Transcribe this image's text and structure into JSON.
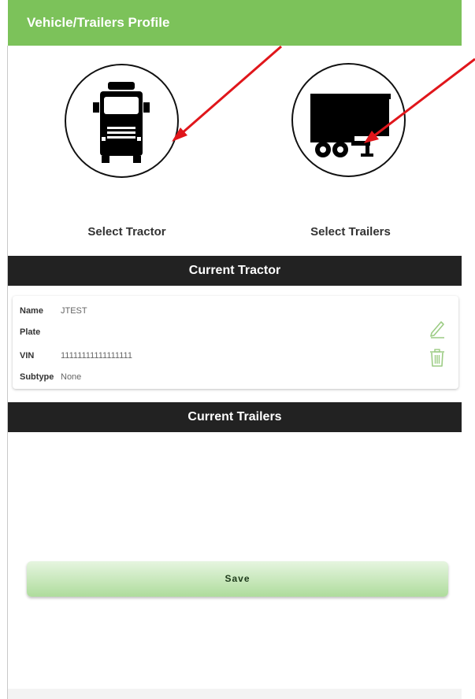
{
  "header": {
    "title": "Vehicle/Trailers Profile"
  },
  "select_tractor": {
    "label": "Select Tractor",
    "icon": "truck-icon"
  },
  "select_trailers": {
    "label": "Select Trailers",
    "icon": "trailer-icon"
  },
  "current_tractor": {
    "heading": "Current Tractor",
    "fields": [
      {
        "label": "Name",
        "value": "JTEST"
      },
      {
        "label": "Plate",
        "value": ""
      },
      {
        "label": "VIN",
        "value": "11111111111111111"
      },
      {
        "label": "Subtype",
        "value": "None"
      }
    ],
    "actions": [
      "edit-icon",
      "delete-icon"
    ]
  },
  "current_trailers": {
    "heading": "Current Trailers"
  },
  "save_button": {
    "label": "Save"
  },
  "colors": {
    "header": "#7cc25a",
    "section_bar": "#222222",
    "action_icons": "#9ccc84",
    "annotation_arrows": "#e0161b"
  }
}
